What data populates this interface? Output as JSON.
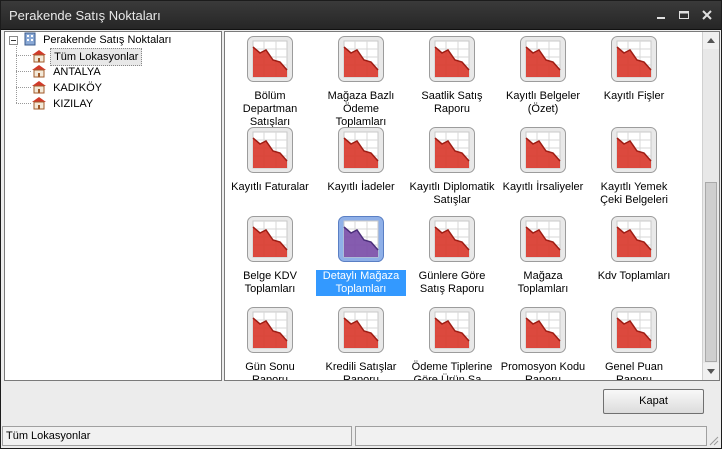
{
  "window": {
    "title": "Perakende Satış Noktaları"
  },
  "tree": {
    "root": "Perakende Satış Noktaları",
    "items": [
      "Tüm Lokasyonlar",
      "ANTALYA",
      "KADIKÖY",
      "KIZILAY"
    ],
    "selected_index": 0
  },
  "reports": [
    {
      "label": "Bölüm Departman Satışları"
    },
    {
      "label": "Mağaza Bazlı Ödeme Toplamları"
    },
    {
      "label": "Saatlik Satış Raporu"
    },
    {
      "label": "Kayıtlı Belgeler (Özet)"
    },
    {
      "label": "Kayıtlı Fişler"
    },
    {
      "label": "Kayıtlı Faturalar"
    },
    {
      "label": "Kayıtlı İadeler"
    },
    {
      "label": "Kayıtlı Diplomatik Satışlar"
    },
    {
      "label": "Kayıtlı İrsaliyeler"
    },
    {
      "label": "Kayıtlı Yemek Çeki Belgeleri"
    },
    {
      "label": "Belge KDV Toplamları"
    },
    {
      "label": "Detaylı Mağaza Toplamları"
    },
    {
      "label": "Günlere Göre Satış Raporu"
    },
    {
      "label": "Mağaza Toplamları"
    },
    {
      "label": "Kdv Toplamları"
    },
    {
      "label": "Gün Sonu Raporu"
    },
    {
      "label": "Kredili Satışlar Raporu"
    },
    {
      "label": "Ödeme Tiplerine Göre Ürün Sa..."
    },
    {
      "label": "Promosyon Kodu Raporu"
    },
    {
      "label": "Genel Puan Raporu"
    }
  ],
  "selected_report_index": 11,
  "buttons": {
    "close_label": "Kapat"
  },
  "status": {
    "location": "Tüm Lokasyonlar"
  },
  "colors": {
    "titlebar": "#2e2e2e",
    "report_icon": "#d9392e",
    "report_icon_selected": "#7b4ea8",
    "selection": "#3399ff"
  }
}
